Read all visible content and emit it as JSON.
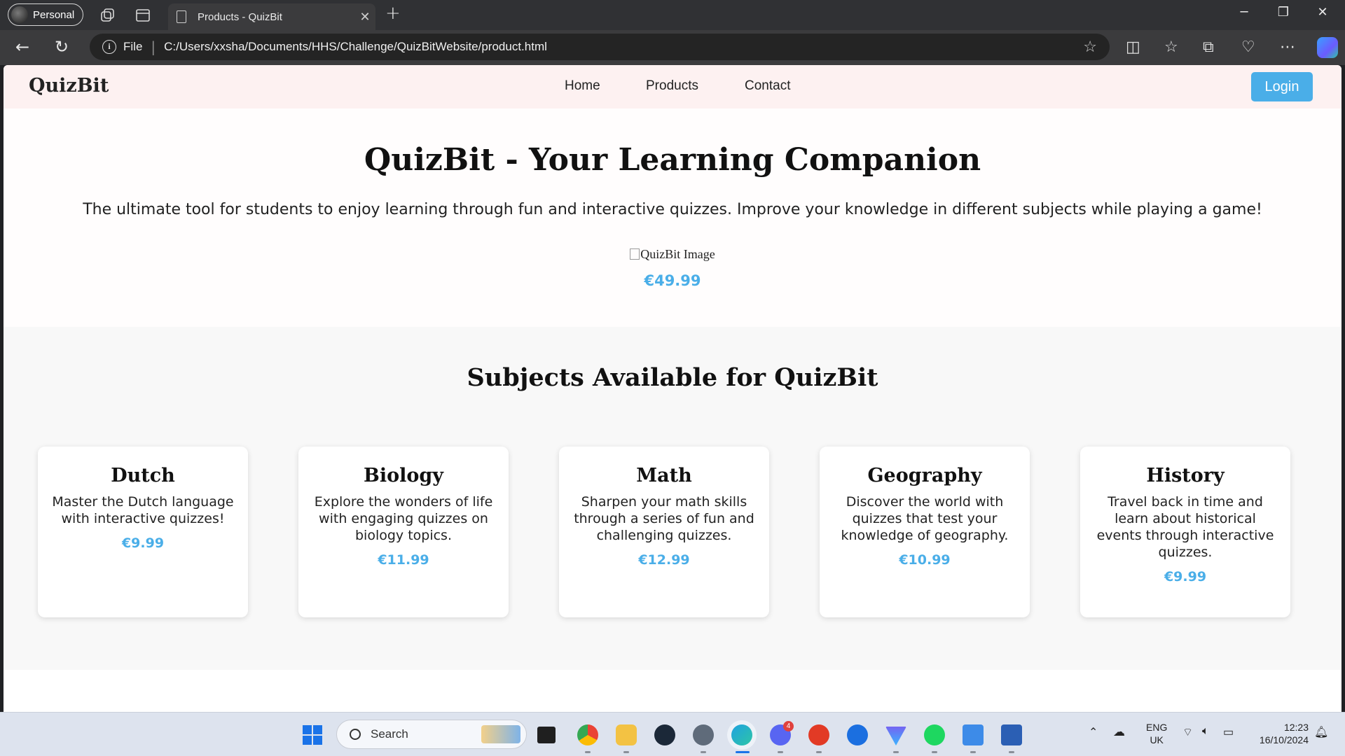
{
  "browser": {
    "profile_label": "Personal",
    "tab_title": "Products - QuizBit",
    "address_scheme": "File",
    "url": "C:/Users/xxsha/Documents/HHS/Challenge/QuizBitWebsite/product.html"
  },
  "site": {
    "logo": "QuizBit",
    "nav": [
      "Home",
      "Products",
      "Contact"
    ],
    "login_label": "Login"
  },
  "hero": {
    "title": "QuizBit - Your Learning Companion",
    "description": "The ultimate tool for students to enjoy learning through fun and interactive quizzes. Improve your knowledge in different subjects while playing a game!",
    "image_alt": "QuizBit Image",
    "price": "€49.99"
  },
  "subjects": {
    "heading": "Subjects Available for QuizBit",
    "cards": [
      {
        "title": "Dutch",
        "description": "Master the Dutch language with interactive quizzes!",
        "price": "€9.99"
      },
      {
        "title": "Biology",
        "description": "Explore the wonders of life with engaging quizzes on biology topics.",
        "price": "€11.99"
      },
      {
        "title": "Math",
        "description": "Sharpen your math skills through a series of fun and challenging quizzes.",
        "price": "€12.99"
      },
      {
        "title": "Geography",
        "description": "Discover the world with quizzes that test your knowledge of geography.",
        "price": "€10.99"
      },
      {
        "title": "History",
        "description": "Travel back in time and learn about historical events through interactive quizzes.",
        "price": "€9.99"
      }
    ]
  },
  "taskbar": {
    "search_label": "Search",
    "language": "ENG",
    "region": "UK",
    "time": "12:23",
    "date": "16/10/2024",
    "discord_badge": "4"
  },
  "colors": {
    "accent": "#4aaee8",
    "header_bg": "#fdf1f1",
    "chrome_bg": "#303134"
  }
}
